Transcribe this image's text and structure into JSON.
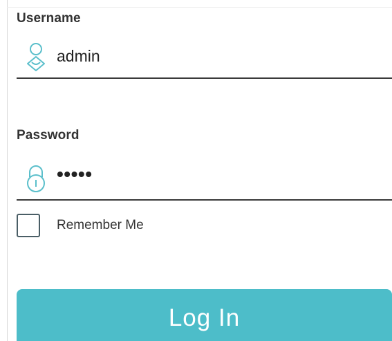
{
  "form": {
    "username": {
      "label": "Username",
      "value": "admin",
      "icon": "user-icon"
    },
    "password": {
      "label": "Password",
      "value": "•••••",
      "icon": "lock-icon"
    },
    "remember": {
      "label": "Remember Me",
      "checked": false
    },
    "login_button_label": "Log In"
  },
  "colors": {
    "accent": "#4dbdc9",
    "icon_color": "#5bbfcb",
    "text": "#333333",
    "underline": "#3a3a3a",
    "checkbox_border": "#4a5e66"
  }
}
